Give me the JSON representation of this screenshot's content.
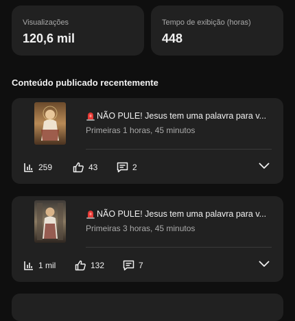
{
  "stats": [
    {
      "label": "Visualizações",
      "value": "120,6 mil"
    },
    {
      "label": "Tempo de exibição (horas)",
      "value": "448"
    }
  ],
  "section_title": "Conteúdo publicado recentemente",
  "videos": [
    {
      "title": "NÃO PULE! Jesus tem uma palavra para v...",
      "subtitle": "Primeiras 1 horas, 45 minutos",
      "views": "259",
      "likes": "43",
      "comments": "2"
    },
    {
      "title": "NÃO PULE! Jesus tem uma palavra para v...",
      "subtitle": "Primeiras 3 horas, 45 minutos",
      "views": "1 mil",
      "likes": "132",
      "comments": "7"
    }
  ],
  "icons": {
    "title_prefix": "siren-icon",
    "views": "bar-chart-icon",
    "likes": "thumbs-up-icon",
    "comments": "comment-icon",
    "expand": "chevron-down-icon"
  },
  "colors": {
    "background": "#0f0f0f",
    "card": "#212121",
    "text": "#f1f1f1",
    "secondary_text": "#aaaaaa",
    "siren": "#e53935"
  }
}
